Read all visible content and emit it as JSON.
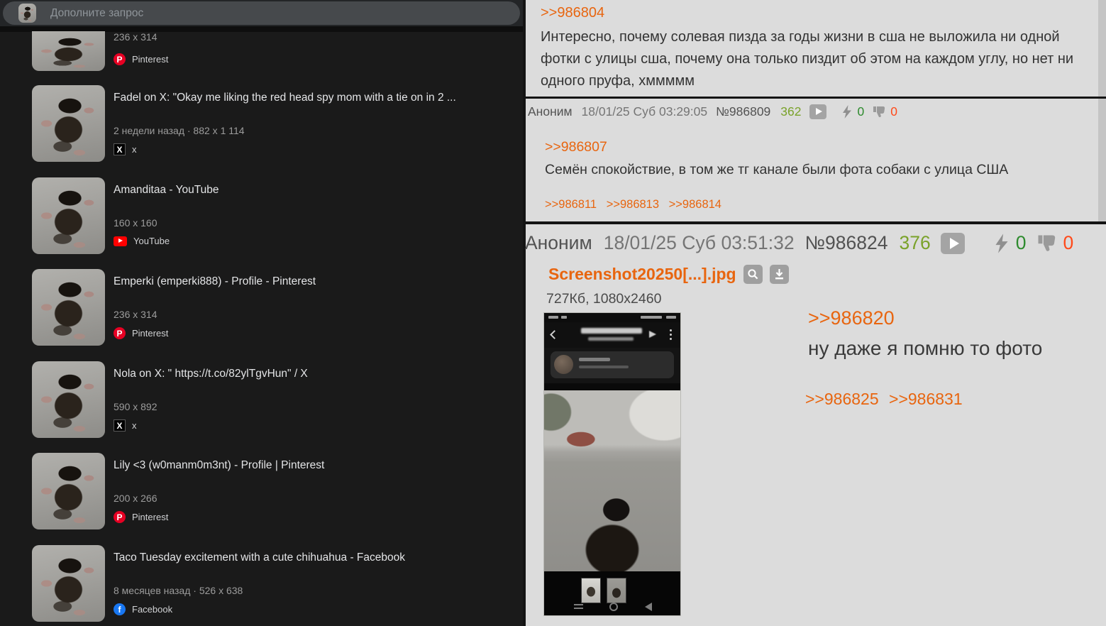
{
  "search": {
    "placeholder": "Дополните запрос"
  },
  "results": [
    {
      "title": "",
      "meta": "236 x 314",
      "source": "Pinterest"
    },
    {
      "title": "Fadel on X: \"Okay me liking the red head spy mom with a tie on in 2 ...",
      "meta": "2 недели назад · 882 x 1 114",
      "source": "x"
    },
    {
      "title": "Amanditaa - YouTube",
      "meta": "160 x 160",
      "source": "YouTube"
    },
    {
      "title": "Emperki (emperki888) - Profile - Pinterest",
      "meta": "236 x 314",
      "source": "Pinterest"
    },
    {
      "title": "Nola on X: \" https://t.co/82ylTgvHun\" / X",
      "meta": "590 x 892",
      "source": "x"
    },
    {
      "title": "Lily <3 (w0manm0m3nt) - Profile | Pinterest",
      "meta": "200 x 266",
      "source": "Pinterest"
    },
    {
      "title": "Taco Tuesday excitement with a cute chihuahua - Facebook",
      "meta": "8 месяцев назад · 526 x 638",
      "source": "Facebook"
    }
  ],
  "icons": {
    "pinterest_glyph": "P",
    "x_glyph": "X",
    "facebook_glyph": "f"
  },
  "thread": {
    "post_top": {
      "reply_link": ">>986804",
      "text": "Интересно, почему солевая пизда за годы жизни в сша не выложила ни одной фотки с улицы сша, почему она только пиздит об этом на каждом углу, но нет ни одного пруфа, хммммм"
    },
    "post_mid": {
      "author": "Аноним",
      "date": "18/01/25 Суб 03:29:05",
      "number": "№986809",
      "count": "362",
      "up": "0",
      "down": "0",
      "reply_link": ">>986807",
      "text": "Семён спокойствие, в том же тг канале были фота собаки с улица США",
      "replies": [
        ">>986811",
        ">>986813",
        ">>986814"
      ]
    },
    "post_big": {
      "author": "Аноним",
      "date": "18/01/25 Суб 03:51:32",
      "number": "№986824",
      "count": "376",
      "up": "0",
      "down": "0",
      "filename": "Screenshot20250[...].jpg",
      "filesize": "727Кб, 1080x2460",
      "reply_link": ">>986820",
      "text": "ну даже я помню то фото",
      "replies": [
        ">>986825",
        ">>986831"
      ]
    }
  },
  "colors": {
    "accent_orange": "#e8650f",
    "count_green": "#7aa22a",
    "zero_green": "#2e8b2e",
    "zero_red": "#ff4a1a",
    "left_bg": "#1a1a1a",
    "right_bg": "#dcdcdc"
  }
}
